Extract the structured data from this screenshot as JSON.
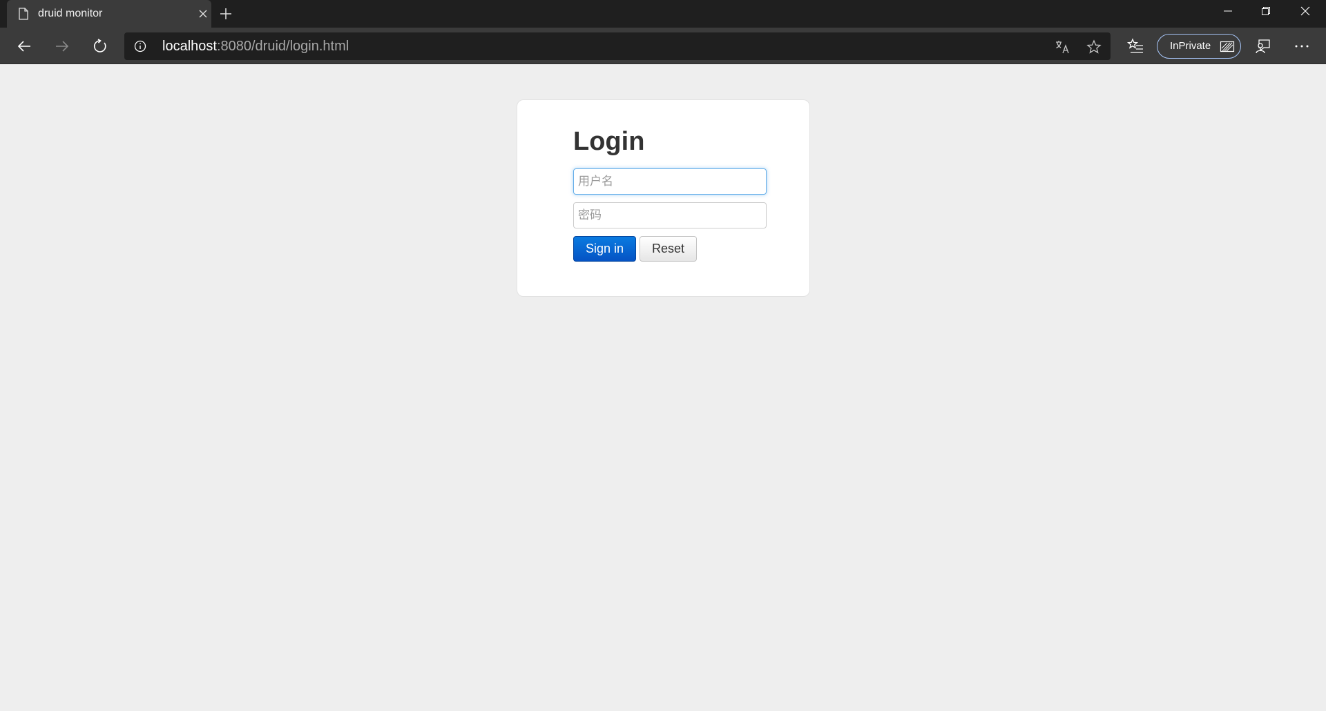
{
  "browser": {
    "tab": {
      "title": "druid monitor"
    },
    "address": {
      "host": "localhost",
      "rest": ":8080/druid/login.html"
    },
    "inprivate_label": "InPrivate",
    "icons": [
      "page-icon",
      "close-icon",
      "plus-icon",
      "minimize-icon",
      "maximize-icon",
      "close-icon",
      "back-arrow-icon",
      "forward-arrow-icon",
      "refresh-icon",
      "info-icon",
      "translate-icon",
      "star-icon",
      "favorites-icon",
      "inprivate-icon",
      "feedback-icon",
      "more-icon"
    ]
  },
  "login": {
    "title": "Login",
    "username_placeholder": "用户名",
    "password_placeholder": "密码",
    "signin_label": "Sign in",
    "reset_label": "Reset"
  },
  "colors": {
    "page_bg": "#eeeeee",
    "signin_button": "#0a6ad6",
    "chrome_dark": "#1f1f1f"
  }
}
